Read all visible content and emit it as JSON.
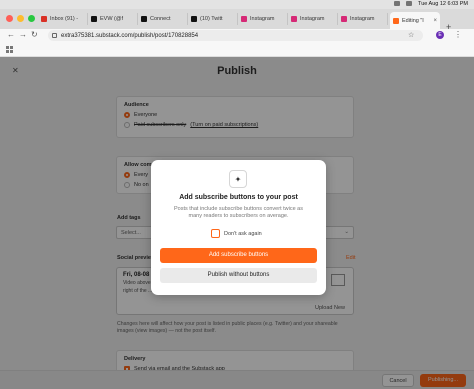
{
  "menubar": {
    "datetime": "Tue Aug 12  6:03 PM"
  },
  "tabs": [
    {
      "label": "Inbox (91) -",
      "color": "#d93025"
    },
    {
      "label": "EVW (@f",
      "color": "#111111"
    },
    {
      "label": "Connect",
      "color": "#111111"
    },
    {
      "label": "(10) Twitt",
      "color": "#111111"
    },
    {
      "label": "Instagram",
      "color": "#d62976"
    },
    {
      "label": "Instagram",
      "color": "#d62976"
    },
    {
      "label": "Instagram",
      "color": "#d62976"
    },
    {
      "label": "Editing \"I",
      "color": "#ff6719"
    }
  ],
  "toolbar": {
    "url": "extra375381.substack.com/publish/post/170828854",
    "profile_initial": "E"
  },
  "page": {
    "title": "Publish",
    "audience_label": "Audience",
    "audience_everyone": "Everyone",
    "audience_paid": "Paid subscribers only",
    "audience_paid_link": "(Turn on paid subscriptions)",
    "allow_comments_label": "Allow comm",
    "allow_everyone": "Every",
    "allow_no": "No on",
    "add_tags_label": "Add tags",
    "tags_placeholder": "Select...",
    "social_preview_label": "Social preview",
    "edit_link": "Edit",
    "preview_title": "Fri, 08-08",
    "preview_desc": "Video above ...",
    "preview_desc2": "right of the ...",
    "upload": "Upload New",
    "hint": "Changes here will affect how your post is listed in public places (e.g. Twitter) and your shareable images (view images) — not the post itself.",
    "delivery_label": "Delivery",
    "delivery_option": "Send via email and the Substack app",
    "cancel": "Cancel",
    "publishing": "Publishing..."
  },
  "modal": {
    "title": "Add subscribe buttons to your post",
    "body": "Posts that include subscribe buttons convert twice as many readers to subscribers on average.",
    "dont_ask": "Don't ask again",
    "primary": "Add subscribe buttons",
    "secondary": "Publish without buttons"
  }
}
